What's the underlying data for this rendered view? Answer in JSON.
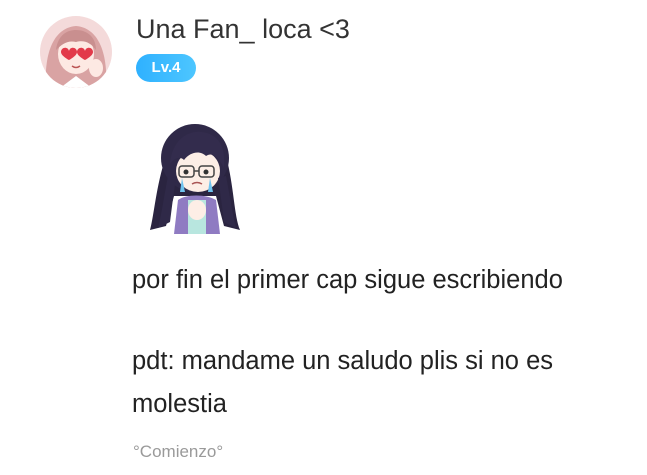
{
  "comment": {
    "author": {
      "name": "Una Fan_ loca <3",
      "level": "Lv.4",
      "avatar_icon": "anime-girl-heart-glasses-avatar"
    },
    "sticker_icon": "crying-anime-girl-sticker",
    "lines": [
      "por fin el primer cap sigue escribiendo",
      "pdt: mandame un saludo plis si no es",
      "molestia"
    ],
    "reply_tag": "°Comienzo°"
  },
  "colors": {
    "badge": "#3bb8ff",
    "username": "#333333",
    "text": "#222222",
    "muted": "#9a9a9a",
    "background": "#ffffff"
  }
}
